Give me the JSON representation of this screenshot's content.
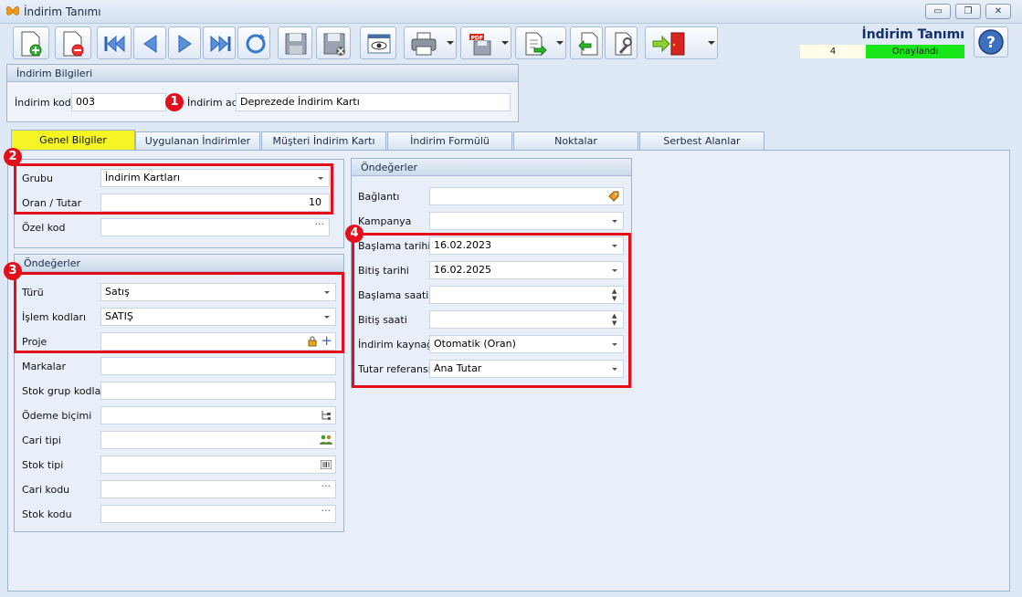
{
  "window": {
    "title": "İndirim Tanımı",
    "minimize_glyph": "▭",
    "restore_glyph": "❐",
    "close_glyph": "✕"
  },
  "header": {
    "doc_title": "İndirim Tanımı",
    "record_count": "4",
    "status": "Onaylandı",
    "status_color": "#19e619"
  },
  "indirim_bilgileri": {
    "title": "İndirim Bilgileri",
    "kod_label": "İndirim kodu",
    "kod_value": "003",
    "ad_label": "İndirim adı",
    "ad_value": "Deprezede İndirim Kartı"
  },
  "tabs": [
    {
      "label": "Genel Bilgiler",
      "active": true
    },
    {
      "label": "Uygulanan İndirimler"
    },
    {
      "label": "Müşteri İndirim Kartı"
    },
    {
      "label": "İndirim Formülü"
    },
    {
      "label": "Noktalar"
    },
    {
      "label": "Serbest Alanlar"
    }
  ],
  "genel": {
    "grubu_label": "Grubu",
    "grubu_value": "İndirim Kartları",
    "oran_label": "Oran / Tutar",
    "oran_value": "10",
    "ozel_label": "Özel kod",
    "ozel_value": ""
  },
  "ondegerler_left": {
    "title": "Öndeğerler",
    "turu_label": "Türü",
    "turu_value": "Satış",
    "islem_label": "İşlem kodları",
    "islem_value": "SATIŞ",
    "proje_label": "Proje",
    "markalar_label": "Markalar",
    "stokgrup_label": "Stok grup kodları",
    "odeme_label": "Ödeme biçimi",
    "caritipi_label": "Cari tipi",
    "stoktipi_label": "Stok tipi",
    "carikodu_label": "Cari kodu",
    "stokkodu_label": "Stok kodu"
  },
  "ondegerler_right": {
    "title": "Öndeğerler",
    "baglanti_label": "Bağlantı",
    "kampanya_label": "Kampanya",
    "baslama_tarihi_label": "Başlama tarihi",
    "baslama_tarihi_value": "16.02.2023",
    "bitis_tarihi_label": "Bitiş tarihi",
    "bitis_tarihi_value": "16.02.2025",
    "baslama_saati_label": "Başlama saati",
    "bitis_saati_label": "Bitiş saati",
    "kaynak_label": "İndirim kaynağı",
    "kaynak_value": "Otomatik (Oran)",
    "referans_label": "Tutar referansı",
    "referans_value": "Ana Tutar"
  },
  "annotations": {
    "n1": "1",
    "n2": "2",
    "n3": "3",
    "n4": "4",
    "color": "#e3101c"
  },
  "icons": {
    "dots": "···",
    "spin": "▲▼",
    "plus": "+"
  }
}
